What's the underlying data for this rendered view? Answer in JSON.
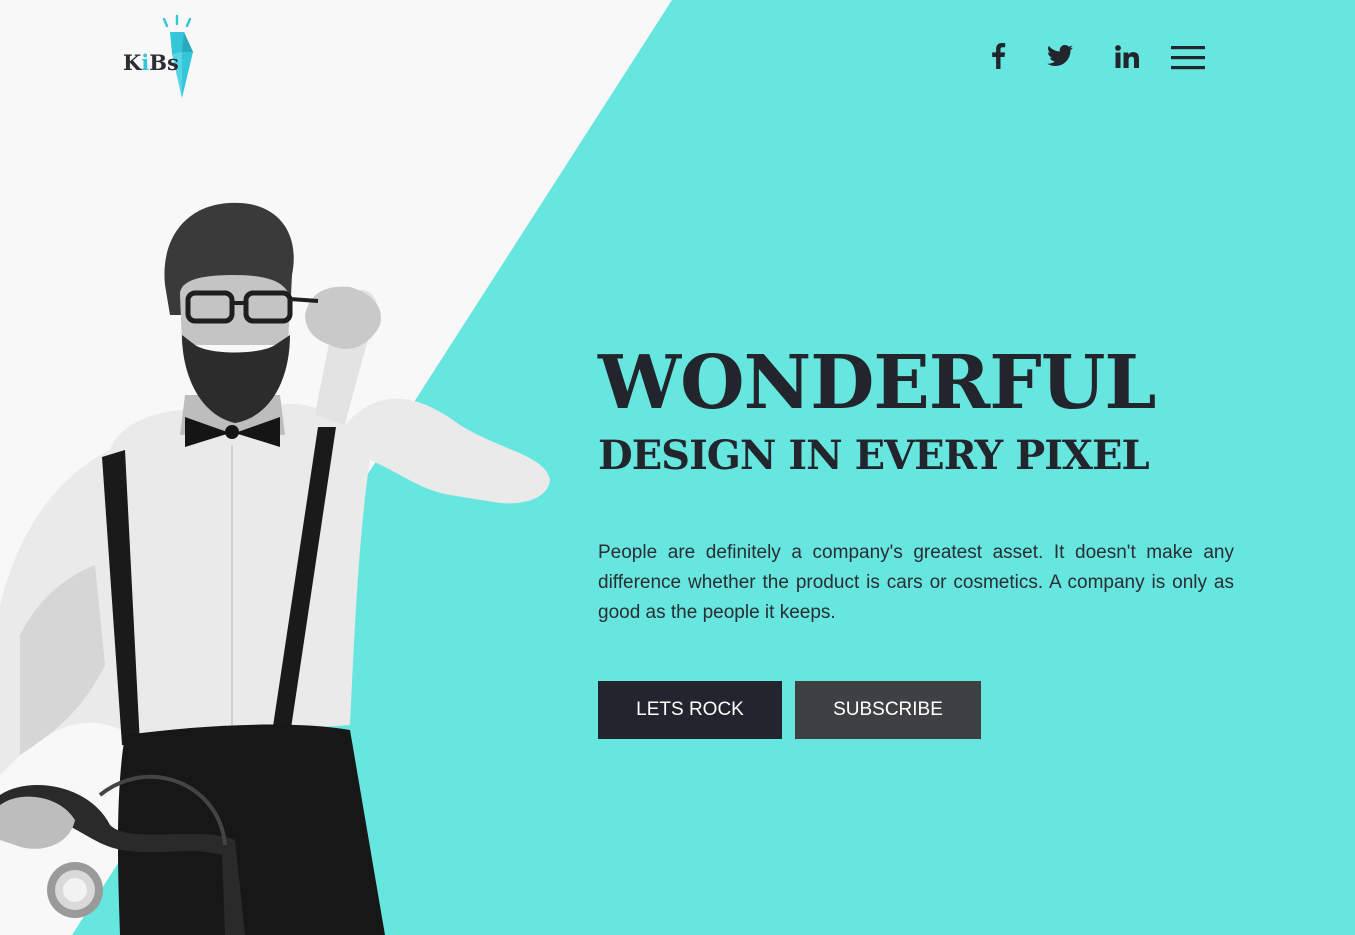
{
  "colors": {
    "accent": "#67e6df",
    "background": "#f8f8f8",
    "text_dark": "#23252c",
    "button_primary": "#22252e",
    "button_secondary": "#3e4042"
  },
  "logo": {
    "part1": "K",
    "part2": "i",
    "part3": "Bs"
  },
  "social": [
    {
      "icon": "facebook-icon"
    },
    {
      "icon": "twitter-icon"
    },
    {
      "icon": "linkedin-icon"
    }
  ],
  "menu": {
    "icon": "hamburger-menu-icon"
  },
  "hero": {
    "title": "WONDERFUL",
    "subtitle": "DESIGN IN EVERY PIXEL",
    "description": "People are definitely a company's greatest asset. It doesn't make any difference whether the product is cars or cosmetics. A company is only as good as the people it keeps.",
    "primary_button": "LETS ROCK",
    "secondary_button": "SUBSCRIBE"
  },
  "image": {
    "icon": "man-with-bicycle-photo"
  }
}
